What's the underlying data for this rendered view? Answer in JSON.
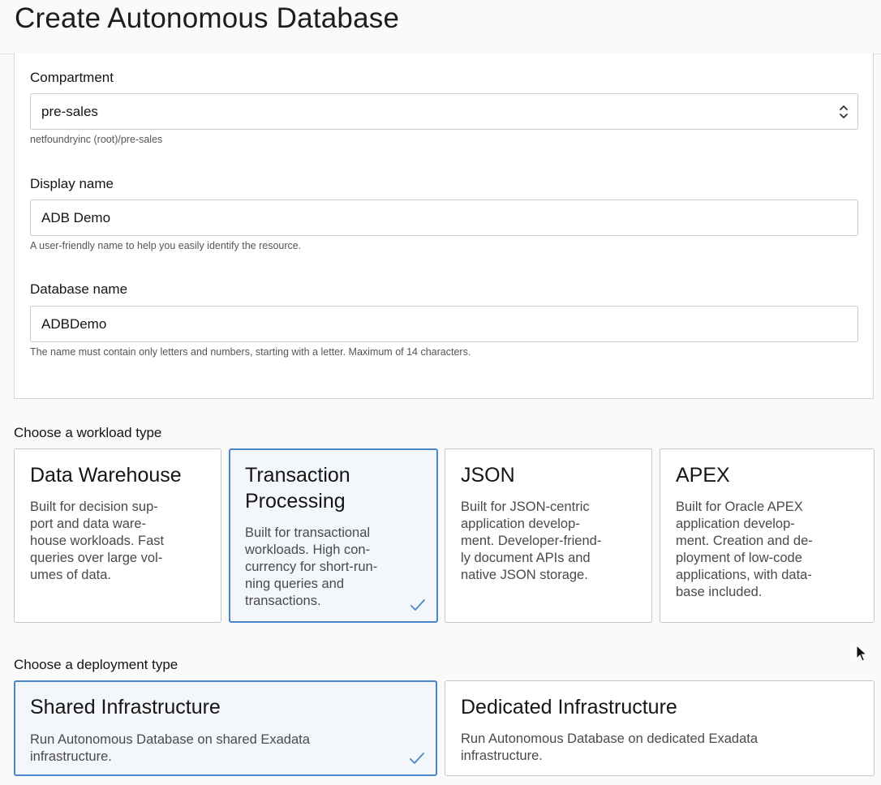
{
  "header": {
    "title": "Create Autonomous Database"
  },
  "form": {
    "compartment": {
      "label": "Compartment",
      "value": "pre-sales",
      "hint": "netfoundryinc (root)/pre-sales"
    },
    "display_name": {
      "label": "Display name",
      "value": "ADB Demo",
      "hint": "A user-friendly name to help you easily identify the resource."
    },
    "database_name": {
      "label": "Database name",
      "value": "ADBDemo",
      "hint": "The name must contain only letters and numbers, starting with a letter. Maximum of 14 characters."
    }
  },
  "workload": {
    "label": "Choose a workload type",
    "selected": "Transaction Processing",
    "options": [
      {
        "title": "Data Warehouse",
        "desc": [
          "Built for decision sup-",
          "port and data ware-",
          "house workloads. Fast",
          "queries over large vol-",
          "umes of data."
        ]
      },
      {
        "title_lines": [
          "Transaction",
          "Processing"
        ],
        "desc": [
          "Built for transactional",
          "workloads. High con-",
          "currency for short-run-",
          "ning queries and",
          "transactions."
        ]
      },
      {
        "title": "JSON",
        "desc": [
          "Built for JSON-centric",
          "application develop-",
          "ment. Developer-friend-",
          "ly document APIs and",
          "native JSON storage."
        ]
      },
      {
        "title": "APEX",
        "desc": [
          "Built for Oracle APEX",
          "application develop-",
          "ment. Creation and de-",
          "ployment of low-code",
          "applications, with data-",
          "base included."
        ]
      }
    ]
  },
  "deployment": {
    "label": "Choose a deployment type",
    "selected": "Shared Infrastructure",
    "options": [
      {
        "title": "Shared Infrastructure",
        "desc": [
          "Run Autonomous Database on shared Exadata",
          "infrastructure."
        ]
      },
      {
        "title": "Dedicated Infrastructure",
        "desc": [
          "Run Autonomous Database on dedicated Exadata",
          "infrastructure."
        ]
      }
    ]
  },
  "colors": {
    "accent": "#4b86c9",
    "selected_bg": "#f3f7fb",
    "border": "#c6c6c6"
  },
  "icons": [
    "chevron-up-down-icon",
    "checkmark-icon",
    "mouse-cursor-icon"
  ]
}
